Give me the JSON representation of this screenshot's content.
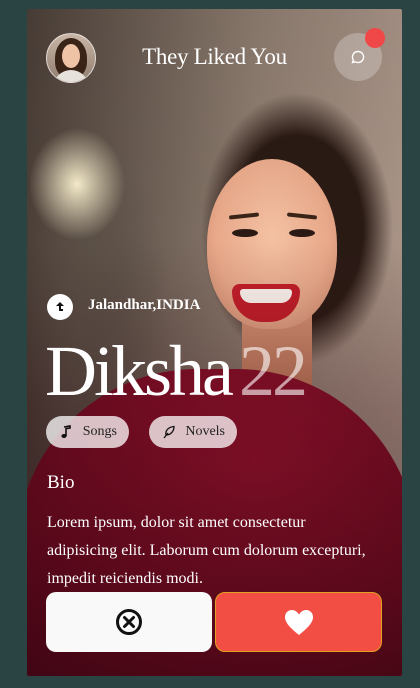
{
  "header": {
    "title": "They Liked You"
  },
  "profile": {
    "location": "Jalandhar,INDIA",
    "name": "Diksha",
    "age": "22"
  },
  "interests": [
    {
      "label": "Songs",
      "icon": "music-note-icon"
    },
    {
      "label": "Novels",
      "icon": "feather-icon"
    }
  ],
  "bio": {
    "heading": "Bio",
    "text": "Lorem ipsum, dolor sit amet consectetur adipisicing elit. Laborum cum dolorum excepturi, impedit reiciendis modi."
  },
  "actions": {
    "reject_icon": "close-circle-icon",
    "like_icon": "heart-icon"
  },
  "colors": {
    "like": "#f24e43",
    "reject": "#f9f9f9",
    "notification": "#f04848",
    "page_bg": "#2a4443"
  }
}
